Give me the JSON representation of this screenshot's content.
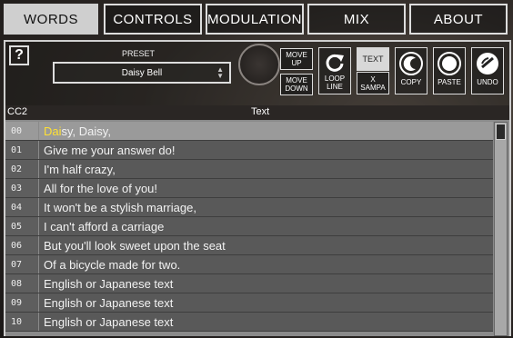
{
  "tabs": [
    {
      "label": "WORDS",
      "active": true
    },
    {
      "label": "CONTROLS",
      "active": false
    },
    {
      "label": "MODULATION",
      "active": false
    },
    {
      "label": "MIX",
      "active": false
    },
    {
      "label": "ABOUT",
      "active": false
    }
  ],
  "toolbar": {
    "help_label": "?",
    "preset_label": "PRESET",
    "preset_value": "Daisy Bell",
    "move_up_label": "MOVE UP",
    "move_down_label": "MOVE DOWN",
    "loop_line_label": "LOOP LINE",
    "text_label": "TEXT",
    "xsampa_label": "X SAMPA",
    "copy_label": "COPY",
    "paste_label": "PASTE",
    "undo_label": "UNDO"
  },
  "table": {
    "columns": [
      "CC2",
      "Text"
    ],
    "selected_row": 0,
    "highlight": "Dai",
    "rows": [
      {
        "cc": "00",
        "text": "Daisy, Daisy,",
        "highlight": "Dai",
        "rest": "sy, Daisy,"
      },
      {
        "cc": "01",
        "text": "Give me your answer do!"
      },
      {
        "cc": "02",
        "text": "I'm half crazy,"
      },
      {
        "cc": "03",
        "text": "All for the love of you!"
      },
      {
        "cc": "04",
        "text": "It won't be a stylish marriage,"
      },
      {
        "cc": "05",
        "text": "I can't afford a carriage"
      },
      {
        "cc": "06",
        "text": "But you'll look sweet upon the seat"
      },
      {
        "cc": "07",
        "text": "Of a bicycle made for two."
      },
      {
        "cc": "08",
        "text": "English or Japanese text"
      },
      {
        "cc": "09",
        "text": "English or Japanese text"
      },
      {
        "cc": "10",
        "text": "English or Japanese text"
      }
    ]
  },
  "colors": {
    "highlight": "#ffe033",
    "tab_active_bg": "#cfcfcf",
    "row_bg": "#595959",
    "row_selected_bg": "#9a9a9a"
  }
}
